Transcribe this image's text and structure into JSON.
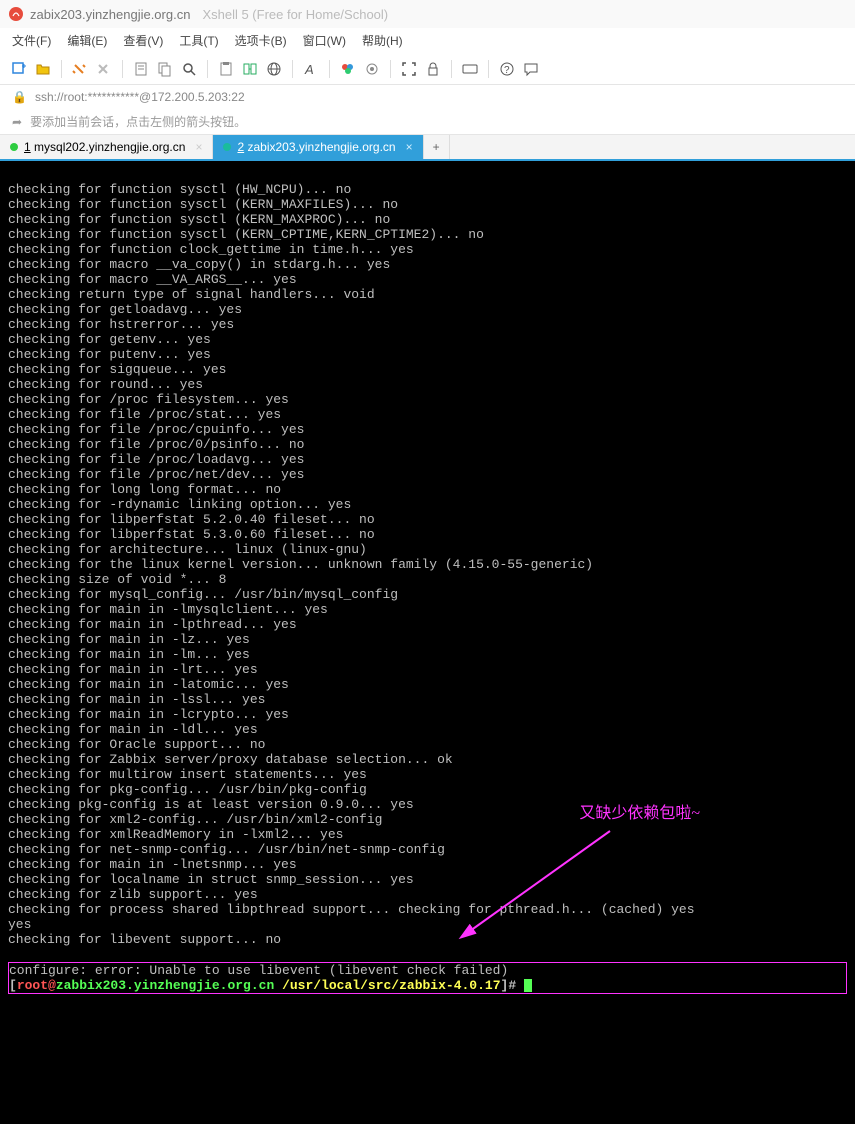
{
  "title": {
    "main": "zabix203.yinzhengjie.org.cn",
    "sub": "Xshell 5 (Free for Home/School)"
  },
  "menu": [
    "文件(F)",
    "编辑(E)",
    "查看(V)",
    "工具(T)",
    "选项卡(B)",
    "窗口(W)",
    "帮助(H)"
  ],
  "address": "ssh://root:***********@172.200.5.203:22",
  "infobar": "要添加当前会话，点击左侧的箭头按钮。",
  "tabs": [
    {
      "label": "1 mysql202.yinzhengjie.org.cn",
      "active": false,
      "dot": "green"
    },
    {
      "label": "2 zabix203.yinzhengjie.org.cn",
      "active": true,
      "dot": "teal"
    }
  ],
  "annotation": "又缺少依赖包啦~",
  "terminal_lines": [
    "checking for function sysctl (HW_NCPU)... no",
    "checking for function sysctl (KERN_MAXFILES)... no",
    "checking for function sysctl (KERN_MAXPROC)... no",
    "checking for function sysctl (KERN_CPTIME,KERN_CPTIME2)... no",
    "checking for function clock_gettime in time.h... yes",
    "checking for macro __va_copy() in stdarg.h... yes",
    "checking for macro __VA_ARGS__... yes",
    "checking return type of signal handlers... void",
    "checking for getloadavg... yes",
    "checking for hstrerror... yes",
    "checking for getenv... yes",
    "checking for putenv... yes",
    "checking for sigqueue... yes",
    "checking for round... yes",
    "checking for /proc filesystem... yes",
    "checking for file /proc/stat... yes",
    "checking for file /proc/cpuinfo... yes",
    "checking for file /proc/0/psinfo... no",
    "checking for file /proc/loadavg... yes",
    "checking for file /proc/net/dev... yes",
    "checking for long long format... no",
    "checking for -rdynamic linking option... yes",
    "checking for libperfstat 5.2.0.40 fileset... no",
    "checking for libperfstat 5.3.0.60 fileset... no",
    "checking for architecture... linux (linux-gnu)",
    "checking for the linux kernel version... unknown family (4.15.0-55-generic)",
    "checking size of void *... 8",
    "checking for mysql_config... /usr/bin/mysql_config",
    "checking for main in -lmysqlclient... yes",
    "checking for main in -lpthread... yes",
    "checking for main in -lz... yes",
    "checking for main in -lm... yes",
    "checking for main in -lrt... yes",
    "checking for main in -latomic... yes",
    "checking for main in -lssl... yes",
    "checking for main in -lcrypto... yes",
    "checking for main in -ldl... yes",
    "checking for Oracle support... no",
    "checking for Zabbix server/proxy database selection... ok",
    "checking for multirow insert statements... yes",
    "checking for pkg-config... /usr/bin/pkg-config",
    "checking pkg-config is at least version 0.9.0... yes",
    "checking for xml2-config... /usr/bin/xml2-config",
    "checking for xmlReadMemory in -lxml2... yes",
    "checking for net-snmp-config... /usr/bin/net-snmp-config",
    "checking for main in -lnetsnmp... yes",
    "checking for localname in struct snmp_session... yes",
    "checking for zlib support... yes",
    "checking for process shared libpthread support... checking for pthread.h... (cached) yes",
    "yes",
    "checking for libevent support... no"
  ],
  "error_line": "configure: error: Unable to use libevent (libevent check failed)",
  "prompt": {
    "open": "[",
    "user": "root@",
    "host": "zabbix203.yinzhengjie.org.cn",
    "sep": " ",
    "path": "/usr/local/src/zabbix-4.0.17",
    "close": "]#"
  }
}
